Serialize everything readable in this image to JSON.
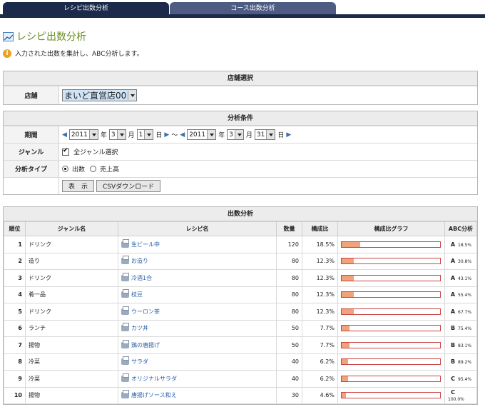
{
  "tabs": [
    {
      "label": "レシピ出数分析"
    },
    {
      "label": "コース出数分析"
    }
  ],
  "page": {
    "title": "レシピ出数分析",
    "info": "入力された出数を集計し、ABC分析します。"
  },
  "store": {
    "header": "店舗選択",
    "label": "店舗",
    "selected": "まいど直営店00"
  },
  "conditions": {
    "header": "分析条件",
    "period_label": "期間",
    "from": {
      "year": "2011",
      "month": "3",
      "day": "1"
    },
    "to": {
      "year": "2011",
      "month": "3",
      "day": "31"
    },
    "year_unit": "年",
    "month_unit": "月",
    "day_unit": "日",
    "tilde": "～",
    "genre_label": "ジャンル",
    "genre_all": "全ジャンル選択",
    "type_label": "分析タイプ",
    "type_options": [
      "出数",
      "売上高"
    ],
    "show_button": "表　示",
    "csv_button": "CSVダウンロード"
  },
  "result": {
    "header": "出数分析",
    "columns": [
      "順位",
      "ジャンル名",
      "レシピ名",
      "数量",
      "構成比",
      "構成比グラフ",
      "ABC分析"
    ],
    "rows": [
      {
        "rank": "1",
        "genre": "ドリンク",
        "recipe": "生ビール中",
        "qty": "120",
        "ratio": "18.5%",
        "ratio_value": 18.5,
        "grade": "A",
        "cum": "18.5%"
      },
      {
        "rank": "2",
        "genre": "造り",
        "recipe": "お造り",
        "qty": "80",
        "ratio": "12.3%",
        "ratio_value": 12.3,
        "grade": "A",
        "cum": "30.8%"
      },
      {
        "rank": "3",
        "genre": "ドリンク",
        "recipe": "冷酒1合",
        "qty": "80",
        "ratio": "12.3%",
        "ratio_value": 12.3,
        "grade": "A",
        "cum": "43.1%"
      },
      {
        "rank": "4",
        "genre": "肴一品",
        "recipe": "枝豆",
        "qty": "80",
        "ratio": "12.3%",
        "ratio_value": 12.3,
        "grade": "A",
        "cum": "55.4%"
      },
      {
        "rank": "5",
        "genre": "ドリンク",
        "recipe": "ウーロン茶",
        "qty": "80",
        "ratio": "12.3%",
        "ratio_value": 12.3,
        "grade": "A",
        "cum": "67.7%"
      },
      {
        "rank": "6",
        "genre": "ランチ",
        "recipe": "カツ丼",
        "qty": "50",
        "ratio": "7.7%",
        "ratio_value": 7.7,
        "grade": "B",
        "cum": "75.4%"
      },
      {
        "rank": "7",
        "genre": "揚物",
        "recipe": "鶏の唐揚げ",
        "qty": "50",
        "ratio": "7.7%",
        "ratio_value": 7.7,
        "grade": "B",
        "cum": "83.1%"
      },
      {
        "rank": "8",
        "genre": "冷菜",
        "recipe": "サラダ",
        "qty": "40",
        "ratio": "6.2%",
        "ratio_value": 6.2,
        "grade": "B",
        "cum": "89.2%"
      },
      {
        "rank": "9",
        "genre": "冷菜",
        "recipe": "オリジナルサラダ",
        "qty": "40",
        "ratio": "6.2%",
        "ratio_value": 6.2,
        "grade": "C",
        "cum": "95.4%"
      },
      {
        "rank": "10",
        "genre": "揚物",
        "recipe": "唐揚げソース和え",
        "qty": "30",
        "ratio": "4.6%",
        "ratio_value": 4.6,
        "grade": "C",
        "cum": "100.0%"
      }
    ]
  },
  "colors": {
    "navy": "#1b2a4a",
    "bar": "#f0a27a",
    "link": "#2b5fa8",
    "title": "#6b8e23"
  }
}
